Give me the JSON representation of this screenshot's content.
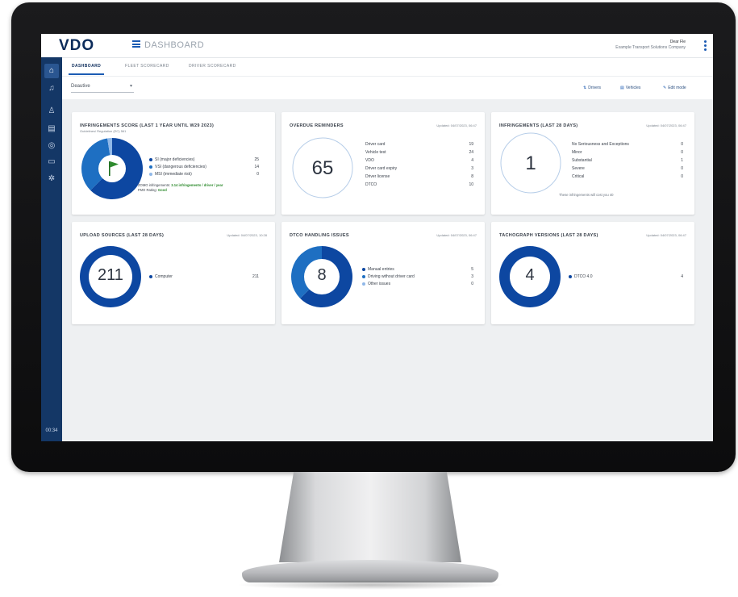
{
  "app": {
    "logo": "VDO",
    "title": "DASHBOARD",
    "user_name": "Dear Fle",
    "user_company": "Example Transport Solutions Company"
  },
  "tabs": [
    {
      "label": "DASHBOARD",
      "active": true
    },
    {
      "label": "FLEET SCORECARD",
      "active": false
    },
    {
      "label": "DRIVER SCORECARD",
      "active": false
    }
  ],
  "toolbar": {
    "select_value": "Deautive",
    "drivers_label": "Drivers",
    "vehicles_label": "Vehicles",
    "edit_label": "Edit mode"
  },
  "sidebar": {
    "icons": [
      "home-icon",
      "bell-icon",
      "user-icon",
      "document-icon",
      "globe-icon",
      "truck-icon",
      "gear-icon"
    ],
    "time": "00:34"
  },
  "cards": {
    "infringements_score": {
      "title": "INFRINGEMENTS SCORE (LAST 1 YEAR UNTIL W29 2023)",
      "subtitle": "Guidelines/ Regulation (EC) 561",
      "items": [
        {
          "label": "SI (major deficiencies)",
          "value": "25",
          "color": "#0d47a1"
        },
        {
          "label": "VSI (dangerous deficiencies)",
          "value": "14",
          "color": "#1e6fc2"
        },
        {
          "label": "MSI (immediate risk)",
          "value": "0",
          "color": "#90b8e8"
        }
      ],
      "note_line1": "ZOMO infringements:",
      "note_highlight": "3.14 infringements / driver / year",
      "note_line2": "FMO Rating:",
      "note_rating": "Good",
      "donut": [
        25,
        14,
        1
      ]
    },
    "overdue_reminders": {
      "title": "OVERDUE REMINDERS",
      "updated": "Updated: 04/07/2023, 06:47",
      "total": "65",
      "items": [
        {
          "label": "Driver card",
          "value": "19"
        },
        {
          "label": "Vehicle test",
          "value": "24"
        },
        {
          "label": "VDO",
          "value": "4"
        },
        {
          "label": "Driver card expiry",
          "value": "3"
        },
        {
          "label": "Driver license",
          "value": "8"
        },
        {
          "label": "DTCO",
          "value": "10"
        }
      ]
    },
    "infringements_28": {
      "title": "INFRINGEMENTS (LAST 28 DAYS)",
      "updated": "Updated: 04/07/2023, 06:47",
      "total": "1",
      "items": [
        {
          "label": "No Seriousness and Exceptions",
          "value": "0"
        },
        {
          "label": "Minor",
          "value": "0"
        },
        {
          "label": "Substantial",
          "value": "1"
        },
        {
          "label": "Severe",
          "value": "0"
        },
        {
          "label": "Critical",
          "value": "0"
        }
      ],
      "footer": "These infringements will cost you 40"
    },
    "upload_sources": {
      "title": "UPLOAD SOURCES (LAST 28 DAYS)",
      "updated": "Updated: 04/07/2023, 10:28",
      "total": "211",
      "items": [
        {
          "label": "Computer",
          "value": "211",
          "color": "#0d47a1"
        }
      ],
      "donut": [
        211
      ]
    },
    "dtco_handling": {
      "title": "DTCO HANDLING ISSUES",
      "updated": "Updated: 04/07/2023, 06:47",
      "total": "8",
      "items": [
        {
          "label": "Manual entries",
          "value": "5",
          "color": "#0d47a1"
        },
        {
          "label": "Driving without driver card",
          "value": "3",
          "color": "#1e6fc2"
        },
        {
          "label": "Other issues",
          "value": "0",
          "color": "#90b8e8"
        }
      ],
      "donut": [
        5,
        3,
        0
      ]
    },
    "tacho_versions": {
      "title": "TACHOGRAPH VERSIONS (LAST 28 DAYS)",
      "updated": "Updated: 04/07/2023, 06:47",
      "total": "4",
      "items": [
        {
          "label": "DTCO 4.0",
          "value": "4",
          "color": "#0d47a1"
        }
      ],
      "donut": [
        4
      ]
    }
  }
}
